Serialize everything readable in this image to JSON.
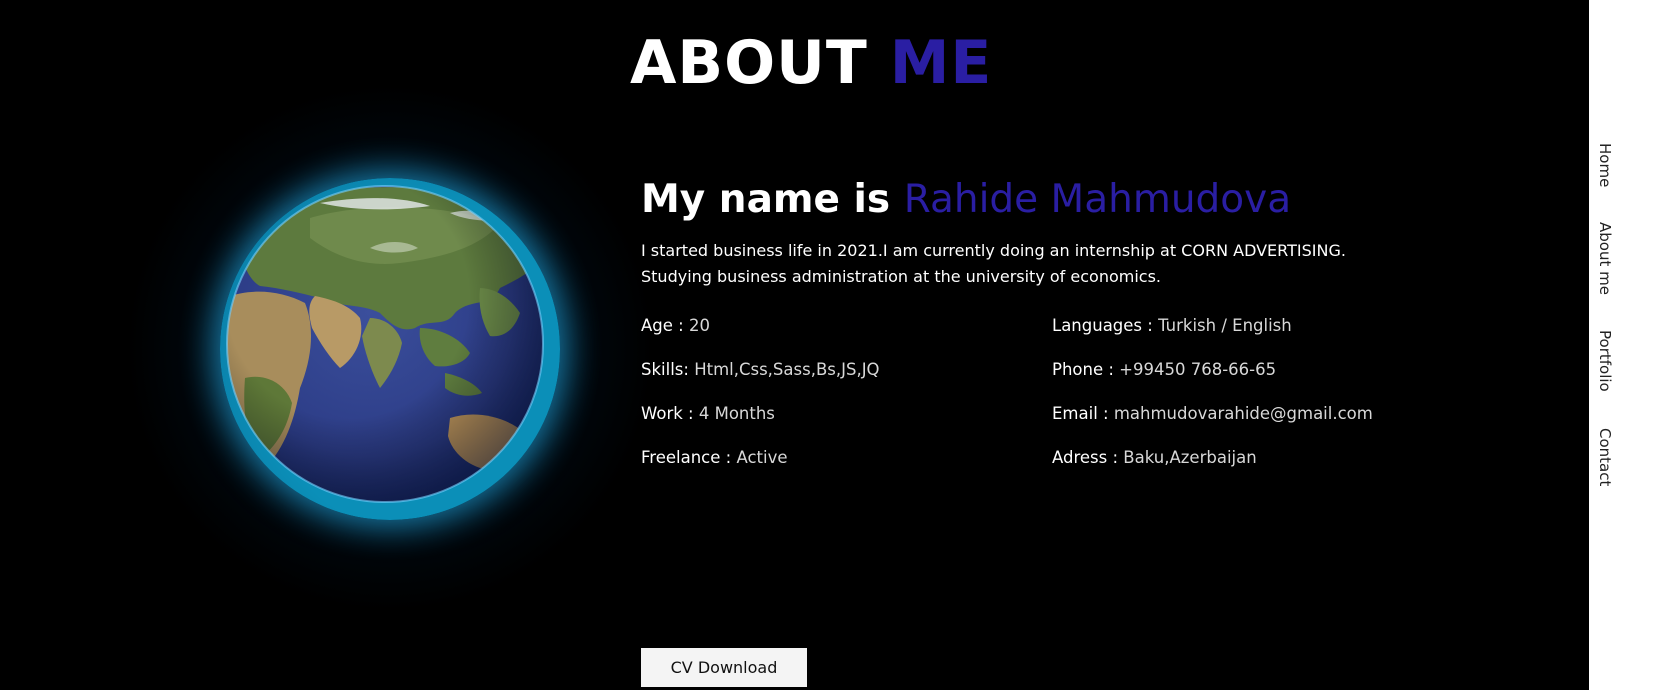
{
  "header": {
    "title_main": "ABOUT",
    "title_accent": "ME"
  },
  "about": {
    "heading_main": "My name is",
    "heading_accent": "Rahide Mahmudova",
    "intro": "I started business life in 2021.I am currently doing an internship at CORN ADVERTISING. Studying business administration at the university of economics.",
    "info_left": [
      {
        "label": "Age :",
        "value": "20"
      },
      {
        "label": "Skills:",
        "value": "Html,Css,Sass,Bs,JS,JQ"
      },
      {
        "label": "Work :",
        "value": "4 Months"
      },
      {
        "label": "Freelance :",
        "value": "Active"
      }
    ],
    "info_right": [
      {
        "label": "Languages :",
        "value": "Turkish / English"
      },
      {
        "label": "Phone :",
        "value": "+99450 768-66-65"
      },
      {
        "label": "Email :",
        "value": "mahmudovarahide@gmail.com"
      },
      {
        "label": "Adress :",
        "value": "Baku,Azerbaijan"
      }
    ],
    "cv_button": "CV Download"
  },
  "nav": {
    "items": [
      "Home",
      "About me",
      "Portfolio",
      "Contact"
    ]
  },
  "colors": {
    "accent": "#2a1ea3",
    "background": "#000000",
    "nav_background": "#ffffff",
    "globe_glow": "#0b8fb8"
  },
  "icons": {
    "globe": "earth-globe-image"
  }
}
